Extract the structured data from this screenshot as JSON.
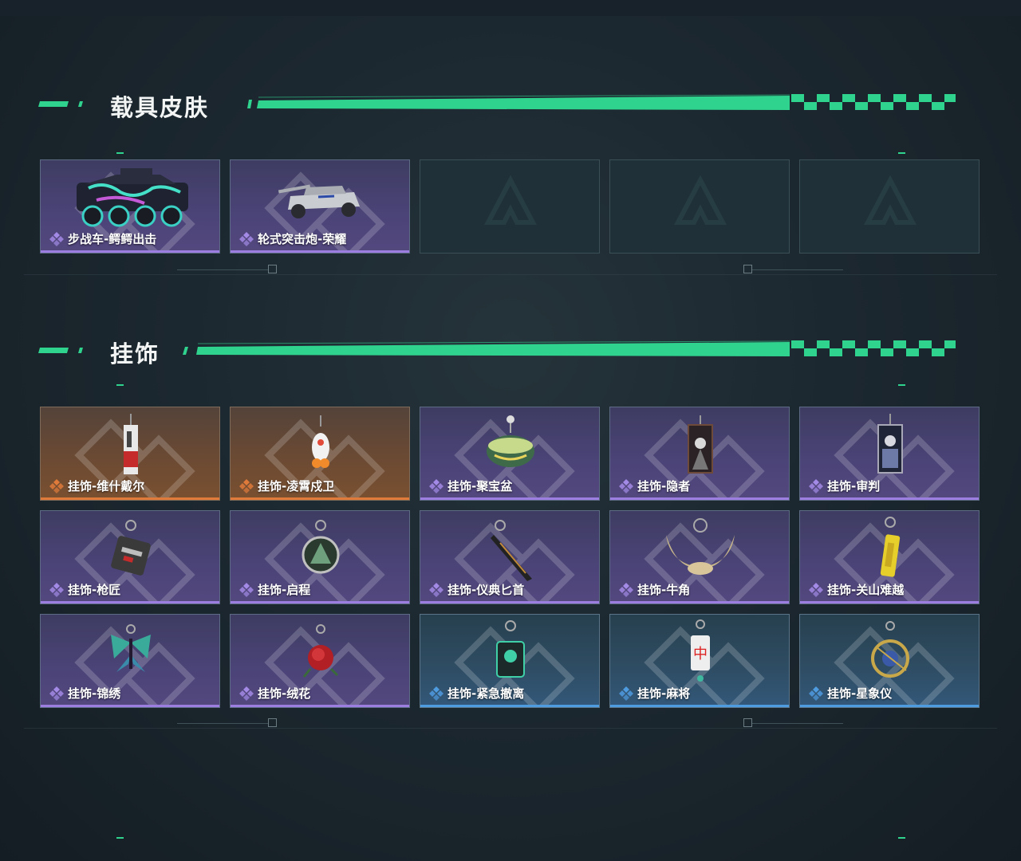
{
  "sections": [
    {
      "title": "载具皮肤",
      "items": [
        {
          "label": "步战车-鳄鳄出击",
          "rarity": "purple",
          "icon": "armored-vehicle-graffiti-icon"
        },
        {
          "label": "轮式突击炮-荣耀",
          "rarity": "purple",
          "icon": "wheeled-assault-gun-icon"
        },
        {
          "label": "",
          "rarity": "empty",
          "icon": "placeholder-logo-icon"
        },
        {
          "label": "",
          "rarity": "empty",
          "icon": "placeholder-logo-icon"
        },
        {
          "label": "",
          "rarity": "empty",
          "icon": "placeholder-logo-icon"
        }
      ]
    },
    {
      "title": "挂饰",
      "items": [
        {
          "label": "挂饰-维什戴尔",
          "rarity": "orange",
          "icon": "figure-charm-icon"
        },
        {
          "label": "挂饰-凌霄戍卫",
          "rarity": "orange",
          "icon": "guardian-charm-icon"
        },
        {
          "label": "挂饰-聚宝盆",
          "rarity": "purple",
          "icon": "treasure-bowl-charm-icon"
        },
        {
          "label": "挂饰-隐者",
          "rarity": "purple",
          "icon": "hermit-card-charm-icon"
        },
        {
          "label": "挂饰-审判",
          "rarity": "purple",
          "icon": "judgement-card-charm-icon"
        },
        {
          "label": "挂饰-枪匠",
          "rarity": "purple",
          "icon": "gunsmith-tag-charm-icon"
        },
        {
          "label": "挂饰-启程",
          "rarity": "purple",
          "icon": "departure-medal-charm-icon"
        },
        {
          "label": "挂饰-仪典匕首",
          "rarity": "purple",
          "icon": "ceremonial-dagger-charm-icon"
        },
        {
          "label": "挂饰-牛角",
          "rarity": "purple",
          "icon": "bull-horn-charm-icon"
        },
        {
          "label": "挂饰-关山难越",
          "rarity": "purple",
          "icon": "gold-bar-charm-icon"
        },
        {
          "label": "挂饰-锦绣",
          "rarity": "purple",
          "icon": "butterfly-charm-icon"
        },
        {
          "label": "挂饰-绒花",
          "rarity": "purple",
          "icon": "rose-charm-icon"
        },
        {
          "label": "挂饰-紧急撤离",
          "rarity": "blue",
          "icon": "emergency-exit-charm-icon"
        },
        {
          "label": "挂饰-麻将",
          "rarity": "blue",
          "icon": "mahjong-tile-charm-icon"
        },
        {
          "label": "挂饰-星象仪",
          "rarity": "blue",
          "icon": "astrolabe-charm-icon"
        }
      ]
    }
  ],
  "colors": {
    "accent": "#2fd38e",
    "purple": "#9b7ee0",
    "orange": "#e07a3a",
    "blue": "#4f9be0"
  }
}
